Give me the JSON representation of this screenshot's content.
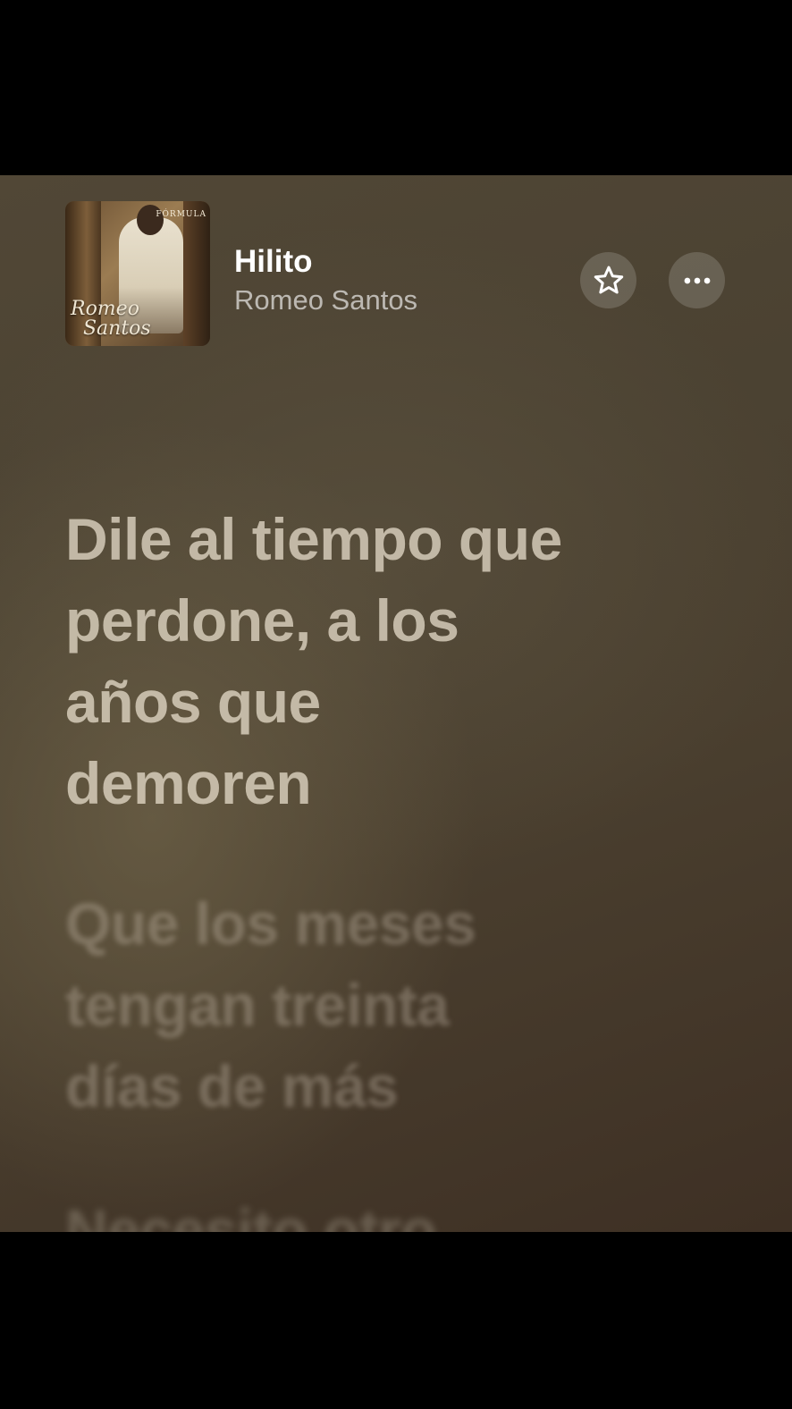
{
  "now_playing": {
    "title": "Hilito",
    "artist": "Romeo Santos",
    "album_art": {
      "badge": "FÓRMULA",
      "script": "Romeo\n  Santos"
    }
  },
  "actions": {
    "favorite_icon": "star-icon",
    "more_icon": "ellipsis-icon"
  },
  "lyrics": {
    "current": "Dile al tiempo que perdone, a los años que demoren",
    "next": "Que los meses tengan treinta días de más",
    "after": "Necesito otro"
  },
  "colors": {
    "background": "#4b4232",
    "title": "#ffffff",
    "artist": "#a9a59d",
    "lyric_active": "#cfc6b2"
  }
}
